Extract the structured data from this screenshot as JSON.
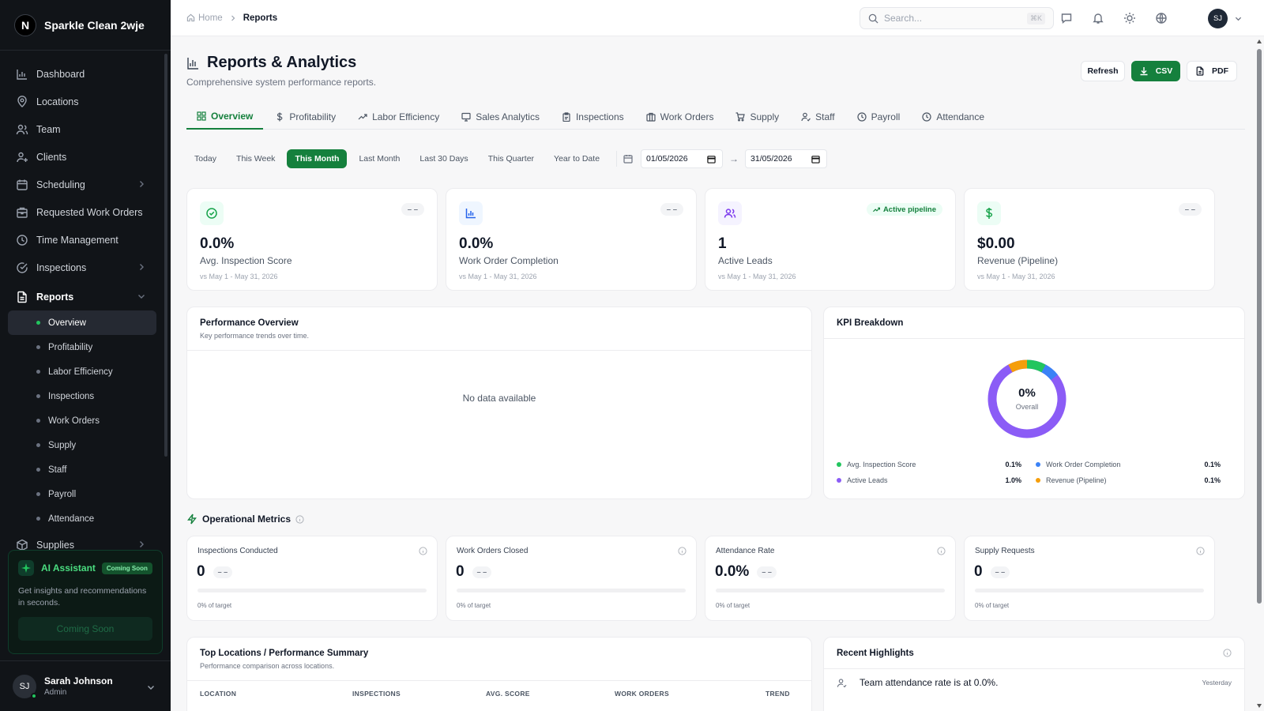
{
  "app": {
    "name": "Sparkle Clean 2wje",
    "logo_letter": "N"
  },
  "sidebar": {
    "items": [
      {
        "label": "Dashboard",
        "icon": "chart-bar-icon"
      },
      {
        "label": "Locations",
        "icon": "map-pin-icon"
      },
      {
        "label": "Team",
        "icon": "users-icon"
      },
      {
        "label": "Clients",
        "icon": "user-plus-icon"
      },
      {
        "label": "Scheduling",
        "icon": "calendar-icon"
      },
      {
        "label": "Requested Work Orders",
        "icon": "building-icon"
      },
      {
        "label": "Time Management",
        "icon": "clock-icon"
      },
      {
        "label": "Inspections",
        "icon": "check-circle-icon"
      },
      {
        "label": "Reports",
        "icon": "file-text-icon"
      }
    ],
    "report_sub_items": [
      "Overview",
      "Profitability",
      "Labor Efficiency",
      "Inspections",
      "Work Orders",
      "Supply",
      "Staff",
      "Payroll",
      "Attendance"
    ],
    "next_item": "Supplies",
    "ai": {
      "title": "AI Assistant",
      "badge": "Coming Soon",
      "description": "Get insights and recommendations in seconds.",
      "button": "Coming Soon"
    },
    "user": {
      "initials": "SJ",
      "name": "Sarah Johnson",
      "role": "Admin"
    }
  },
  "topbar": {
    "breadcrumb": {
      "home": "Home",
      "current": "Reports"
    },
    "search": {
      "placeholder": "Search...",
      "shortcut": "⌘K"
    },
    "avatar_initials": "SJ"
  },
  "page": {
    "title": "Reports & Analytics",
    "subtitle": "Comprehensive system performance reports."
  },
  "actions": {
    "refresh": "Refresh",
    "csv": "CSV",
    "pdf": "PDF"
  },
  "tabs": [
    "Overview",
    "Profitability",
    "Labor Efficiency",
    "Sales Analytics",
    "Inspections",
    "Work Orders",
    "Supply",
    "Staff",
    "Payroll",
    "Attendance"
  ],
  "active_tab": "Overview",
  "date_ranges": [
    "Today",
    "This Week",
    "This Month",
    "Last Month",
    "Last 30 Days",
    "This Quarter",
    "Year to Date"
  ],
  "active_range": "This Month",
  "date_from": "01/05/2026",
  "date_to": "31/05/2026",
  "date_arrow": "→",
  "kpis": [
    {
      "value": "0.0%",
      "label": "Avg. Inspection Score",
      "badge": "– –",
      "compare": "vs May 1 - May 31, 2026",
      "icon": "check-circle-icon",
      "color": "#16a34a"
    },
    {
      "value": "0.0%",
      "label": "Work Order Completion",
      "badge": "– –",
      "compare": "vs May 1 - May 31, 2026",
      "icon": "bar-chart-icon",
      "color": "#2563eb"
    },
    {
      "value": "1",
      "label": "Active Leads",
      "badge": "Active pipeline",
      "compare": "vs May 1 - May 31, 2026",
      "icon": "users-icon",
      "color": "#7c3aed"
    },
    {
      "value": "$0.00",
      "label": "Revenue (Pipeline)",
      "badge": "– –",
      "compare": "vs May 1 - May 31, 2026",
      "icon": "dollar-icon",
      "color": "#16a34a"
    }
  ],
  "performance": {
    "title": "Performance Overview",
    "subtitle": "Key performance trends over time.",
    "empty": "No data available"
  },
  "kpi_breakdown": {
    "title": "KPI Breakdown",
    "center_value": "0%",
    "center_label": "Overall",
    "legend": [
      {
        "label": "Avg. Inspection Score",
        "value": "0.1%",
        "color": "#22c55e"
      },
      {
        "label": "Work Order Completion",
        "value": "0.1%",
        "color": "#3b82f6"
      },
      {
        "label": "Active Leads",
        "value": "1.0%",
        "color": "#8b5cf6"
      },
      {
        "label": "Revenue (Pipeline)",
        "value": "0.1%",
        "color": "#f59e0b"
      }
    ]
  },
  "operational": {
    "title": "Operational Metrics",
    "metrics": [
      {
        "label": "Inspections Conducted",
        "value": "0",
        "change": "– –",
        "target": "0% of target",
        "progress": 0
      },
      {
        "label": "Work Orders Closed",
        "value": "0",
        "change": "– –",
        "target": "0% of target",
        "progress": 0
      },
      {
        "label": "Attendance Rate",
        "value": "0.0%",
        "change": "– –",
        "target": "0% of target",
        "progress": 0
      },
      {
        "label": "Supply Requests",
        "value": "0",
        "change": "– –",
        "target": "0% of target",
        "progress": 0
      }
    ]
  },
  "top_locations": {
    "title": "Top Locations / Performance Summary",
    "subtitle": "Performance comparison across locations.",
    "columns": [
      "LOCATION",
      "INSPECTIONS",
      "AVG. SCORE",
      "WORK ORDERS",
      "TREND"
    ]
  },
  "highlights": {
    "title": "Recent Highlights",
    "items": [
      {
        "text": "Team attendance rate is at 0.0%.",
        "time": "Yesterday"
      }
    ]
  },
  "colors": {
    "accent": "#15803d",
    "sidebar_bg": "#111418"
  }
}
